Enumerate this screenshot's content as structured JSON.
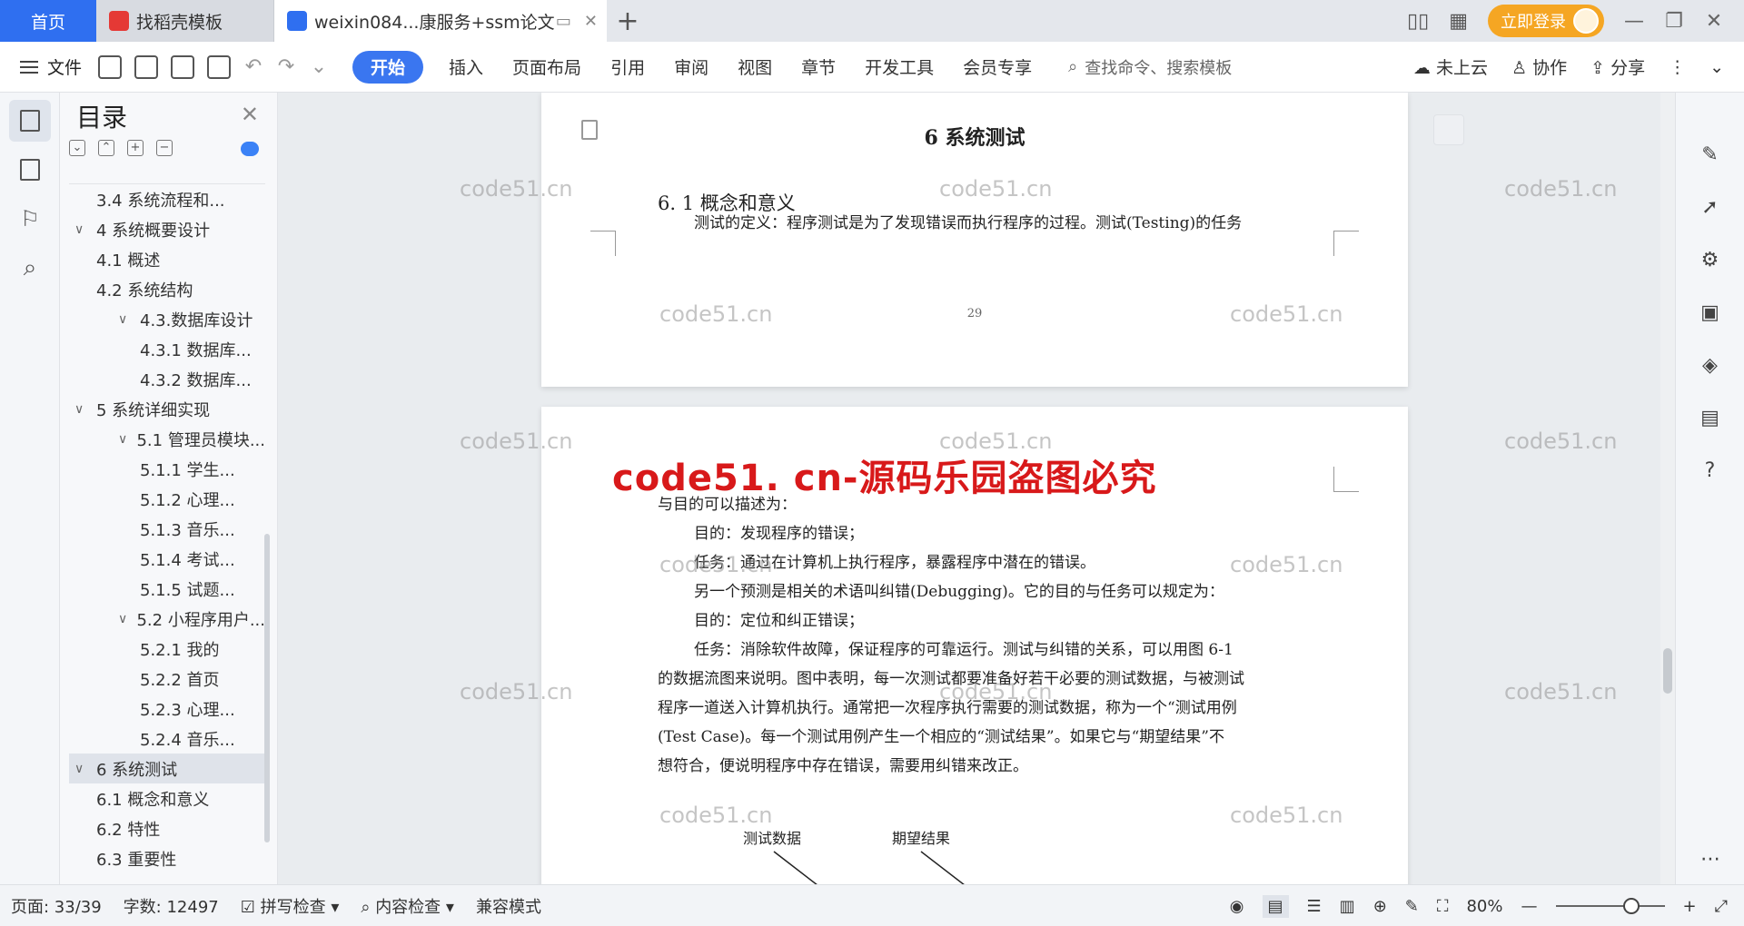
{
  "tabs": {
    "home": "首页",
    "template": "找稻壳模板",
    "document": "weixin084...康服务+ssm论文",
    "new_tab": "+"
  },
  "header": {
    "login": "立即登录"
  },
  "ribbon": {
    "file": "文件",
    "tabs": [
      "开始",
      "插入",
      "页面布局",
      "引用",
      "审阅",
      "视图",
      "章节",
      "开发工具",
      "会员专享"
    ],
    "search_placeholder": "查找命令、搜索模板",
    "cloud": "未上云",
    "collab": "协作",
    "share": "分享"
  },
  "toc": {
    "title": "目录",
    "items": [
      {
        "level": "l2",
        "text": "3.4 系统流程和...",
        "chev": ""
      },
      {
        "level": "l1",
        "text": "4 系统概要设计",
        "chev": "∨"
      },
      {
        "level": "l2",
        "text": "4.1 概述",
        "chev": ""
      },
      {
        "level": "l2",
        "text": "4.2 系统结构",
        "chev": ""
      },
      {
        "level": "l2n",
        "text": "4.3.数据库设计",
        "chev": "∨"
      },
      {
        "level": "l3",
        "text": "4.3.1 数据库...",
        "chev": ""
      },
      {
        "level": "l3",
        "text": "4.3.2 数据库...",
        "chev": ""
      },
      {
        "level": "l1",
        "text": "5 系统详细实现",
        "chev": "∨"
      },
      {
        "level": "l2n",
        "text": "5.1 管理员模块...",
        "chev": "∨"
      },
      {
        "level": "l3",
        "text": "5.1.1 学生...",
        "chev": ""
      },
      {
        "level": "l3",
        "text": "5.1.2 心理...",
        "chev": ""
      },
      {
        "level": "l3",
        "text": "5.1.3 音乐...",
        "chev": ""
      },
      {
        "level": "l3",
        "text": "5.1.4 考试...",
        "chev": ""
      },
      {
        "level": "l3",
        "text": "5.1.5 试题...",
        "chev": ""
      },
      {
        "level": "l2n",
        "text": "5.2 小程序用户...",
        "chev": "∨"
      },
      {
        "level": "l3",
        "text": "5.2.1 我的",
        "chev": ""
      },
      {
        "level": "l3",
        "text": "5.2.2 首页",
        "chev": ""
      },
      {
        "level": "l3",
        "text": "5.2.3 心理...",
        "chev": ""
      },
      {
        "level": "l3",
        "text": "5.2.4 音乐...",
        "chev": ""
      },
      {
        "level": "l1",
        "text": "6 系统测试",
        "chev": "∨",
        "selected": true
      },
      {
        "level": "l2",
        "text": "6.1 概念和意义",
        "chev": ""
      },
      {
        "level": "l2",
        "text": "6.2 特性",
        "chev": ""
      },
      {
        "level": "l2",
        "text": "6.3 重要性",
        "chev": ""
      }
    ]
  },
  "document": {
    "chapter_title": "6 系统测试",
    "section_title": "6. 1 概念和意义",
    "page1_para": "测试的定义：程序测试是为了发现错误而执行程序的过程。测试(Testing)的任务",
    "page_number": "29",
    "stamp": "code51. cn-源码乐园盗图必究",
    "page2_lines": [
      "与目的可以描述为：",
      "目的：发现程序的错误；",
      "任务：通过在计算机上执行程序，暴露程序中潜在的错误。",
      "另一个预测是相关的术语叫纠错(Debugging)。它的目的与任务可以规定为：",
      "目的：定位和纠正错误；",
      "任务：消除软件故障，保证程序的可靠运行。测试与纠错的关系，可以用图 6-1",
      "的数据流图来说明。图中表明，每一次测试都要准备好若干必要的测试数据，与被测试",
      "程序一道送入计算机执行。通常把一次程序执行需要的测试数据，称为一个“测试用例",
      "(Test Case)。每一个测试用例产生一个相应的“测试结果”。如果它与“期望结果”不",
      "想符合，便说明程序中存在错误，需要用纠错来改正。"
    ],
    "diagram_labels": [
      "测试数据",
      "期望结果"
    ],
    "watermark": "code51.cn"
  },
  "statusbar": {
    "page": "页面: 33/39",
    "words": "字数: 12497",
    "spell": "拼写检查",
    "content": "内容检查",
    "compat": "兼容模式",
    "zoom": "80%"
  }
}
